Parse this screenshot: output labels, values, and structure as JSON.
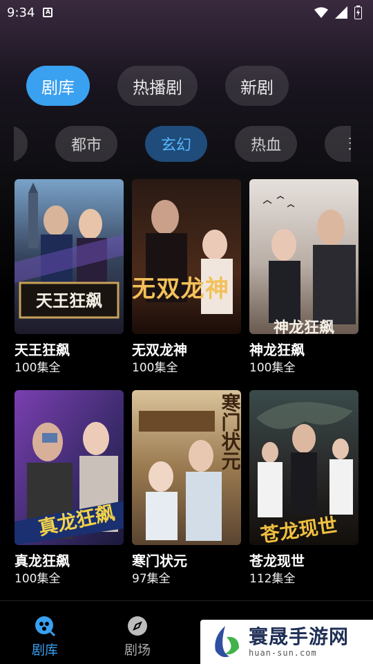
{
  "status": {
    "time": "9:34",
    "notif_glyph": "A"
  },
  "top_tabs": [
    {
      "label": "剧库",
      "active": true
    },
    {
      "label": "热播剧",
      "active": false
    },
    {
      "label": "新剧",
      "active": false
    }
  ],
  "genres": [
    {
      "label": "",
      "active": false
    },
    {
      "label": "都市",
      "active": false
    },
    {
      "label": "玄幻",
      "active": true
    },
    {
      "label": "热血",
      "active": false
    },
    {
      "label": "现",
      "active": false
    }
  ],
  "dramas": [
    {
      "title": "天王狂飙",
      "episodes": "100集全",
      "poster_text": "天王狂飙"
    },
    {
      "title": "无双龙神",
      "episodes": "100集全",
      "poster_text": "无双龙神"
    },
    {
      "title": "神龙狂飙",
      "episodes": "100集全",
      "poster_text": "神龙狂飙"
    },
    {
      "title": "真龙狂飙",
      "episodes": "100集全",
      "poster_text": "真龙狂飙"
    },
    {
      "title": "寒门状元",
      "episodes": "97集全",
      "poster_text": "寒门状元"
    },
    {
      "title": "苍龙现世",
      "episodes": "112集全",
      "poster_text": "苍龙现世"
    }
  ],
  "bottom_nav": [
    {
      "label": "剧库",
      "icon": "library-icon",
      "active": true
    },
    {
      "label": "剧场",
      "icon": "compass-icon",
      "active": false
    }
  ],
  "watermark": {
    "cn": "寰晟手游网",
    "en": "huan-sun.com"
  },
  "colors": {
    "accent": "#3aa0f0",
    "genre_active_bg": "#1f4c7a",
    "genre_active_text": "#56b6ff"
  }
}
